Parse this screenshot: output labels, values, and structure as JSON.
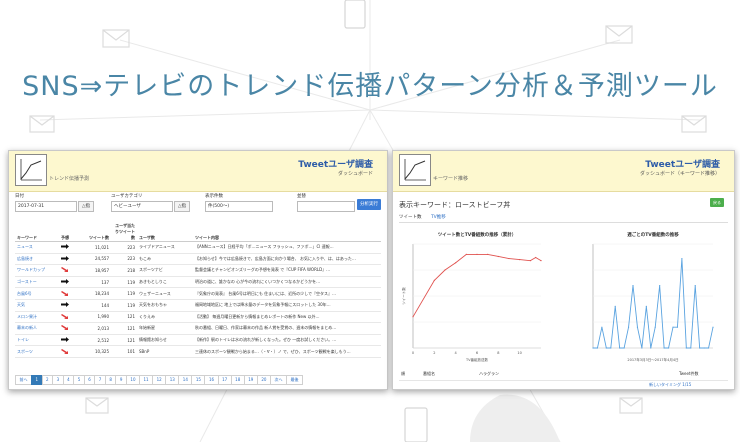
{
  "headline": "SNS⇒テレビのトレンド伝播パターン分析＆予測ツール",
  "left_panel": {
    "logo_label": "トレンド伝播予測",
    "title": "Tweetユーザ調査",
    "subtitle": "ダッシュボード",
    "filters": {
      "date_label": "日付",
      "date_value": "2017-07-31",
      "date_btn": "△指",
      "category_label": "ユーザカテゴリ",
      "category_value": "ヘビーユーザ",
      "category_btn": "△指",
      "count_label": "表示件数",
      "count_value": "件(500〜)",
      "sort_label": "並替",
      "sort_value": "",
      "analyze_button": "分析実行"
    },
    "table": {
      "headers": [
        "キーワード",
        "予想",
        "ツイート数",
        "ユーザ当たりツイート数",
        "ユーザ数",
        "ツイート内容"
      ],
      "rows": [
        {
          "keyword": "ニュース",
          "trend": "up",
          "tweets": "11,021",
          "per_user": "223",
          "users": "ライブドアニュース",
          "content": "【ANNニュース】日経平均「ボ…ニュース フラッシュ、ファボ…」Cl 速報…"
        },
        {
          "keyword": "広島焼き",
          "trend": "up",
          "tweets": "24,557",
          "per_user": "223",
          "users": "もこみ",
          "content": "【お知らせ】今では広島焼きで、広島方面に向かう場合、 お気に入りや、は、はあった…"
        },
        {
          "keyword": "ワールドカップ",
          "trend": "down",
          "tweets": "18,957",
          "per_user": "218",
          "users": "スポーツナビ",
          "content": "監督会議とチャンピオンズリーグの予想を発表 で『CUP FIFA WORLD』…"
        },
        {
          "keyword": "ゴーストー",
          "trend": "up",
          "tweets": "137",
          "per_user": "119",
          "users": "あきもとしりこ",
          "content": "明治の道に、誰かなの 心が今の流れにくいつかくつなるかどうかを…"
        },
        {
          "keyword": "台風6号",
          "trend": "down",
          "tweets": "18,234",
          "per_user": "119",
          "users": "ウェザーニュース",
          "content": "『気象庁の発表』 台風6号は明日にも 住まいには、近所の少しで『空タス』…"
        },
        {
          "keyword": "天気",
          "trend": "up",
          "tweets": "144",
          "per_user": "119",
          "users": "天気をおもちゃ",
          "content": "福岡地域地区に 地上では降水量のデータを気象予報にスロットした 30年…"
        },
        {
          "keyword": "メロン果汁",
          "trend": "down",
          "tweets": "1,990",
          "per_user": "121",
          "users": "くりえみ",
          "content": "【活動】 毎週月曜日更新から情報まとめレポートの新作 New 以外…"
        },
        {
          "keyword": "幕末の新人",
          "trend": "down",
          "tweets": "2,013",
          "per_user": "121",
          "users": "年始新星",
          "content": "秋の番組、日曜日、作家は幕末の作品 新人賞を受賞の、週末の情報をまとめ…"
        },
        {
          "keyword": "トイレ",
          "trend": "up",
          "tweets": "2,512",
          "per_user": "121",
          "users": "情報館お知らせ",
          "content": "【新作】駅のトイレは水の流れが新しくなった。ぜひ 一度お試しください。…"
        },
        {
          "keyword": "スポーツ",
          "trend": "down",
          "tweets": "10,325",
          "per_user": "101",
          "users": "SBnP",
          "content": "三連休のスポーツ観戦から始まる…（・∀・）ノ で、ぜひ、スポーツ観戦を楽しもう…"
        }
      ]
    },
    "pagination": [
      "前へ",
      "1",
      "2",
      "3",
      "4",
      "5",
      "6",
      "7",
      "8",
      "9",
      "10",
      "11",
      "12",
      "13",
      "14",
      "15",
      "16",
      "17",
      "18",
      "19",
      "20",
      "次へ",
      "最後"
    ]
  },
  "right_panel": {
    "logo_label": "キーワード推移",
    "title": "Tweetユーザ調査",
    "subtitle": "ダッシュボード（キーワード推移）",
    "keyword_label": "表示キーワード：ローストビーフ丼",
    "green_button": "戻る",
    "tabs": [
      "ツイート数",
      "TV推移"
    ],
    "tab_active": 0,
    "table": {
      "headers": [
        "順",
        "番組名",
        "ハラグラン",
        "Tweet件数"
      ],
      "row": [
        "",
        "",
        "",
        "新しいタイミング 1/15"
      ]
    }
  },
  "chart_data": [
    {
      "type": "line",
      "title": "ツイート数とTV番組数の推移（累計）",
      "xlabel": "TV番組放送数",
      "ylabel": "ツイート数",
      "xlim": [
        0,
        12
      ],
      "ylim": [
        0,
        1
      ],
      "x": [
        0,
        2,
        3,
        4,
        5,
        6,
        7,
        8,
        9,
        10,
        11,
        11.5,
        12
      ],
      "series": [
        {
          "values": [
            0.3,
            0.65,
            0.75,
            0.82,
            0.9,
            0.9,
            0.9,
            0.88,
            0.86,
            0.85,
            0.84,
            0.87,
            0.84
          ]
        }
      ],
      "color": "#e0524f"
    },
    {
      "type": "line",
      "title": "週ごとのTV番組数の推移",
      "xlabel": "2017年3月3日〜2017年4月4日",
      "ylabel": "",
      "ylim": [
        0,
        5
      ],
      "x": [
        0,
        1,
        2,
        3,
        4,
        5,
        6,
        7,
        8,
        9,
        10,
        11,
        12,
        13,
        14,
        15,
        16,
        17,
        18,
        19,
        20,
        21,
        22,
        23,
        24,
        25,
        26,
        27
      ],
      "series": [
        {
          "values": [
            0,
            0,
            1,
            0,
            0,
            2,
            0,
            0,
            1,
            3,
            1,
            0,
            2,
            0,
            1,
            3,
            0,
            0,
            1,
            1,
            4.3,
            0,
            0,
            3,
            0,
            0,
            0,
            1
          ]
        }
      ],
      "color": "#5aa3e0"
    }
  ]
}
